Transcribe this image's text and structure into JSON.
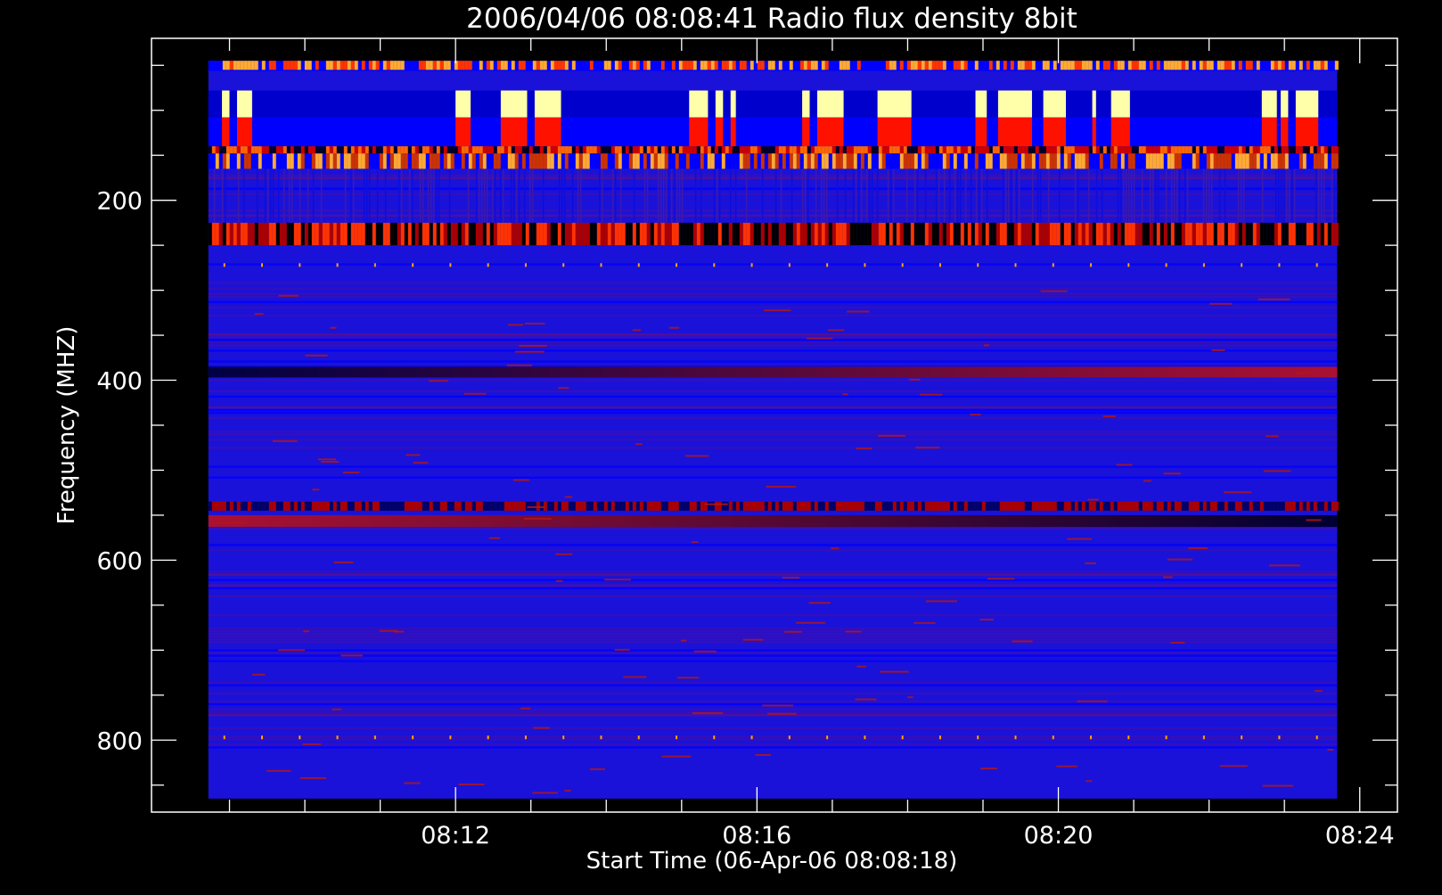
{
  "chart_data": {
    "type": "heatmap",
    "title": "2006/04/06 08:08:41 Radio flux density 8bit",
    "xlabel": "Start Time (06-Apr-06 08:08:18)",
    "ylabel": "Frequency (MHZ)",
    "x_ticks": [
      "08:12",
      "08:16",
      "08:20",
      "08:24"
    ],
    "x_tick_minutes": [
      12,
      16,
      20,
      24
    ],
    "x_minor_tick_minutes": [
      9,
      10,
      11,
      12,
      13,
      14,
      15,
      16,
      17,
      18,
      19,
      20,
      21,
      22,
      23,
      24
    ],
    "xlim_minutes": [
      7.965,
      24.5
    ],
    "data_x_range_minutes": [
      8.72,
      23.7
    ],
    "y_ticks": [
      200,
      400,
      600,
      800
    ],
    "y_minor_ticks": [
      50,
      100,
      150,
      200,
      250,
      300,
      350,
      400,
      450,
      500,
      550,
      600,
      650,
      700,
      750,
      800,
      850
    ],
    "ylim": [
      20,
      880
    ],
    "data_y_range": [
      45,
      865
    ],
    "colorscale": [
      "#000000",
      "#0000ff",
      "#cc0000",
      "#ffa500",
      "#ffffaa"
    ],
    "bands": [
      {
        "f_low": 45,
        "f_high": 55,
        "pattern": "striped",
        "colors": [
          "#ff3300",
          "#ffaa33",
          "#0000ff"
        ]
      },
      {
        "f_low": 78,
        "f_high": 108,
        "pattern": "bursts",
        "colors": [
          "#ffffaa",
          "#0000cc"
        ]
      },
      {
        "f_low": 108,
        "f_high": 140,
        "pattern": "bursts",
        "colors": [
          "#ff1100",
          "#0000ff"
        ]
      },
      {
        "f_low": 140,
        "f_high": 148,
        "pattern": "striped",
        "colors": [
          "#cc0000",
          "#000022",
          "#ff6600"
        ]
      },
      {
        "f_low": 148,
        "f_high": 165,
        "pattern": "striped",
        "colors": [
          "#ffaa33",
          "#cc3300",
          "#0000ff"
        ]
      },
      {
        "f_low": 225,
        "f_high": 250,
        "pattern": "striped",
        "colors": [
          "#000000",
          "#aa0000",
          "#ff3300"
        ]
      },
      {
        "f_low": 385,
        "f_high": 397,
        "pattern": "gradient",
        "colors": [
          "#000044",
          "#aa1133"
        ]
      },
      {
        "f_low": 535,
        "f_high": 545,
        "pattern": "striped",
        "colors": [
          "#000066",
          "#aa0000"
        ]
      },
      {
        "f_low": 550,
        "f_high": 563,
        "pattern": "gradient",
        "colors": [
          "#aa1133",
          "#000033"
        ]
      }
    ],
    "burst_intervals_minutes": [
      [
        8.9,
        9.0
      ],
      [
        9.1,
        9.3
      ],
      [
        12.0,
        12.2
      ],
      [
        12.6,
        12.95
      ],
      [
        13.05,
        13.4
      ],
      [
        15.1,
        15.35
      ],
      [
        15.45,
        15.55
      ],
      [
        15.65,
        15.72
      ],
      [
        16.6,
        16.7
      ],
      [
        16.8,
        17.15
      ],
      [
        17.6,
        18.05
      ],
      [
        18.9,
        19.05
      ],
      [
        19.2,
        19.65
      ],
      [
        19.8,
        20.1
      ],
      [
        20.45,
        20.5
      ],
      [
        20.7,
        20.95
      ],
      [
        22.7,
        22.9
      ],
      [
        22.95,
        23.05
      ],
      [
        23.15,
        23.45
      ]
    ]
  }
}
